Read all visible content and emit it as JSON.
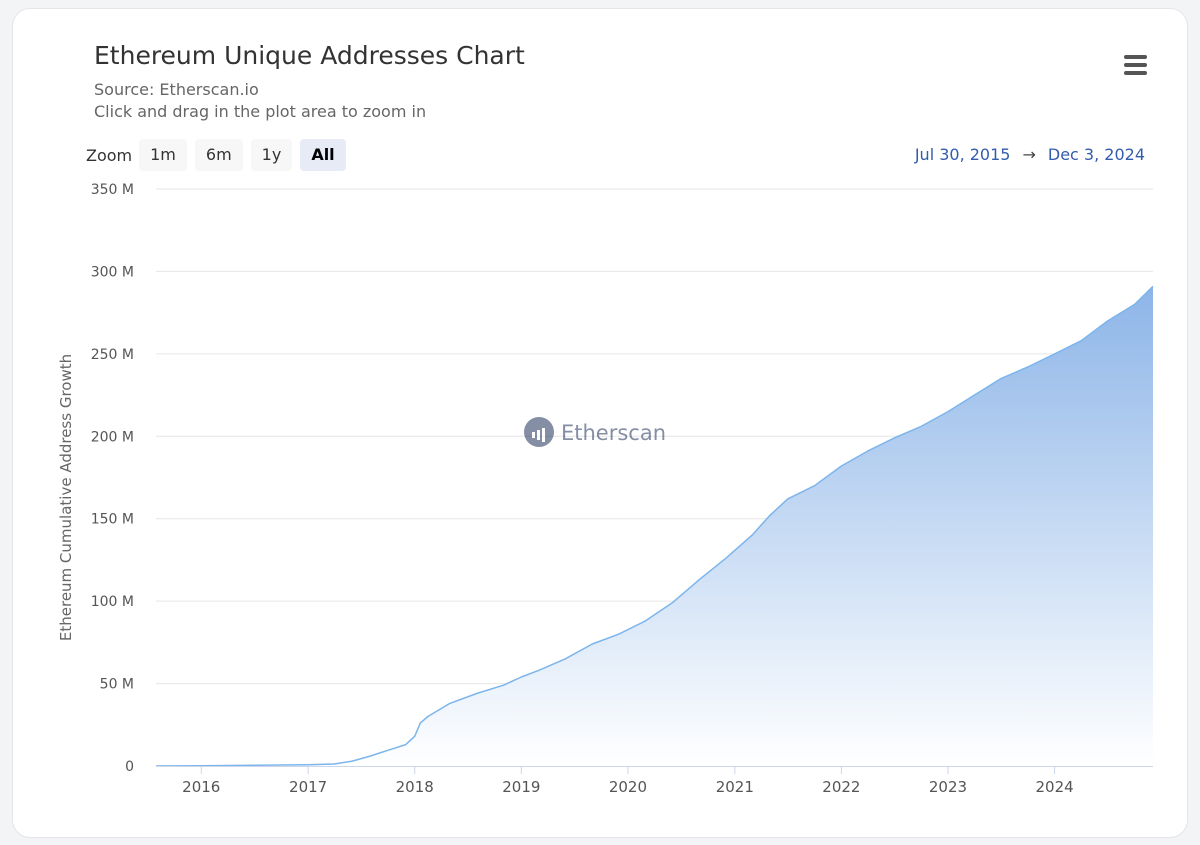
{
  "header": {
    "title": "Ethereum Unique Addresses Chart",
    "source": "Source: Etherscan.io",
    "hint": "Click and drag in the plot area to zoom in",
    "menu_icon": "hamburger-icon"
  },
  "zoom": {
    "label": "Zoom",
    "options": [
      "1m",
      "6m",
      "1y",
      "All"
    ],
    "selected": "All"
  },
  "range": {
    "from": "Jul 30, 2015",
    "arrow": "→",
    "to": "Dec 3, 2024"
  },
  "watermark": {
    "text": "Etherscan",
    "icon": "etherscan-logo-icon"
  },
  "colors": {
    "line": "#7cb5ec",
    "fill_top": "#8db5e8",
    "fill_bottom": "#ffffff",
    "grid": "#e6e6e6",
    "range_text": "#335cad"
  },
  "chart_data": {
    "type": "area",
    "title": "Ethereum Unique Addresses Chart",
    "ylabel": "Ethereum Cumulative Address Growth",
    "xlabel": "",
    "ylim": [
      0,
      350
    ],
    "y_ticks": [
      0,
      50,
      100,
      150,
      200,
      250,
      300,
      350
    ],
    "y_tick_labels": [
      "0",
      "50 M",
      "100 M",
      "150 M",
      "200 M",
      "250 M",
      "300 M",
      "350 M"
    ],
    "x_range": [
      "2015-07-30",
      "2024-12-03"
    ],
    "x_ticks": [
      "2016-01-01",
      "2017-01-01",
      "2018-01-01",
      "2019-01-01",
      "2020-01-01",
      "2021-01-01",
      "2022-01-01",
      "2023-01-01",
      "2024-01-01"
    ],
    "x_tick_labels": [
      "2016",
      "2017",
      "2018",
      "2019",
      "2020",
      "2021",
      "2022",
      "2023",
      "2024"
    ],
    "grid": true,
    "legend": "none",
    "series": [
      {
        "x": [
          "2015-07-30",
          "2016-01-01",
          "2016-07-01",
          "2017-01-01",
          "2017-04-01",
          "2017-06-01",
          "2017-08-01",
          "2017-10-01",
          "2017-12-01",
          "2018-01-01",
          "2018-01-20",
          "2018-02-15",
          "2018-05-01",
          "2018-08-01",
          "2018-11-01",
          "2019-01-01",
          "2019-03-01",
          "2019-06-01",
          "2019-09-01",
          "2019-12-01",
          "2020-03-01",
          "2020-06-01",
          "2020-09-01",
          "2020-12-01",
          "2021-03-01",
          "2021-05-01",
          "2021-07-01",
          "2021-10-01",
          "2022-01-01",
          "2022-04-01",
          "2022-07-01",
          "2022-10-01",
          "2023-01-01",
          "2023-04-01",
          "2023-07-01",
          "2023-10-01",
          "2024-01-01",
          "2024-04-01",
          "2024-07-01",
          "2024-10-01",
          "2024-12-03"
        ],
        "values": [
          0,
          0.1,
          0.4,
          0.8,
          1.2,
          3,
          6,
          9.5,
          13,
          18,
          26,
          30,
          38,
          44,
          49,
          54,
          58,
          65,
          74,
          80,
          88,
          99,
          113,
          126,
          140,
          152,
          162,
          170,
          182,
          191,
          199,
          206,
          215,
          225,
          235,
          242,
          250,
          258,
          270,
          280,
          291
        ]
      }
    ]
  }
}
